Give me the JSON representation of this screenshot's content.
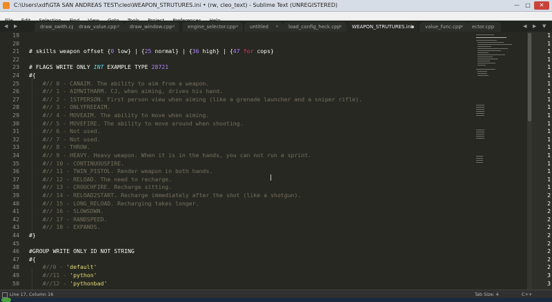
{
  "window": {
    "title": "C:\\Users\\xdf\\GTA SAN ANDREAS TEST\\cleo\\WEAPON_STRUTURES.ini • (rw, cleo_text) - Sublime Text (UNREGISTERED)",
    "minimize_glyph": "—",
    "maximize_glyph": "□",
    "close_glyph": "✕"
  },
  "menu": [
    "File",
    "Edit",
    "Selection",
    "Find",
    "View",
    "Goto",
    "Tools",
    "Project",
    "Preferences",
    "Help"
  ],
  "tab_arrows": {
    "left": "◀",
    "right": "▶",
    "overflow": "▼"
  },
  "tabs": [
    {
      "label": "draw_swith.cpp",
      "close": "×",
      "active": false
    },
    {
      "label": "draw_value.cpp",
      "close": "×",
      "active": false
    },
    {
      "label": "draw_window.cpp",
      "close": "×",
      "active": false
    },
    {
      "label": "engine_selector.cpp",
      "close": "×",
      "active": false
    },
    {
      "label": "untitled",
      "close": "×",
      "active": false
    },
    {
      "label": "load_config_heck.cpp",
      "close": "×",
      "active": false
    },
    {
      "label": "WEAPON_STRUTURES.ini",
      "close": "",
      "active": true
    },
    {
      "label": "value_func.cpp",
      "close": "×",
      "active": false
    },
    {
      "label": "ector.cpp",
      "close": "",
      "active": false
    }
  ],
  "editor": {
    "lines": [
      {
        "num": "19",
        "text": ""
      },
      {
        "num": "20",
        "text": ""
      },
      {
        "num": "21",
        "text": "# skills weapon offset {0 low} | {25 normal} | {36 high} | {47 for cops}"
      },
      {
        "num": "22",
        "text": ""
      },
      {
        "num": "23",
        "text": "# FLAGS WRITE ONLY INT EXAMPLE TYPE 28721"
      },
      {
        "num": "24",
        "text": "#{"
      },
      {
        "num": "25",
        "text": "    #// 0 - CANAIM. The ability to aim from a weapon."
      },
      {
        "num": "26",
        "text": "    #// 1 - AIMWITHARM. CJ, when aiming, drives his hand."
      },
      {
        "num": "27",
        "text": "    #// 2 - 1STPERSON. First person view when aiming (like a grenade launcher and a sniper rifle)."
      },
      {
        "num": "28",
        "text": "    #// 3 - ONLYFREEAIM."
      },
      {
        "num": "29",
        "text": "    #// 4 - MOVEAIM. The ability to move when aiming."
      },
      {
        "num": "30",
        "text": "    #// 5 - MOVEFIRE. The ability to move around when shooting."
      },
      {
        "num": "31",
        "text": "    #// 6 - Not used."
      },
      {
        "num": "32",
        "text": "    #// 7 - Not used."
      },
      {
        "num": "33",
        "text": "    #// 8 - THROW."
      },
      {
        "num": "34",
        "text": "    #// 9 - HEAVY. Heavy weapon. When it is in the hands, you can not run a sprint."
      },
      {
        "num": "35",
        "text": "    #// 10 - CONTINUOUSFIRE."
      },
      {
        "num": "36",
        "text": "    #// 11 - TWIN_PISTOL. Render weapon in both hands."
      },
      {
        "num": "37",
        "text": "    #// 12 - RELOAD. The need to recharge."
      },
      {
        "num": "38",
        "text": "    #// 13 - CROUCHFIRE. Recharge sitting."
      },
      {
        "num": "39",
        "text": "    #// 14 - RELOAD2START. Recharge immediately after the shot (like a shotgun)."
      },
      {
        "num": "40",
        "text": "    #// 15 - LONG_RELOAD. Recharging takes longer."
      },
      {
        "num": "41",
        "text": "    #// 16 - SLOWSDWN."
      },
      {
        "num": "42",
        "text": "    #// 17 - RANDSPEED."
      },
      {
        "num": "43",
        "text": "    #// 18 - EXPANDS."
      },
      {
        "num": "44",
        "text": "#}"
      },
      {
        "num": "45",
        "text": ""
      },
      {
        "num": "46",
        "text": "#GROUP WRITE ONLY ID NOT STRING"
      },
      {
        "num": "47",
        "text": "#{"
      },
      {
        "num": "48",
        "text": "    #//0 - 'default'"
      },
      {
        "num": "49",
        "text": "    #//11 - 'python'"
      },
      {
        "num": "50",
        "text": "    #//12 - 'pythonbad'"
      }
    ]
  },
  "side_numbers": [
    "1",
    "1",
    "1",
    "1",
    "1",
    "1",
    "1",
    "1",
    "1",
    "1",
    "1",
    "1",
    "1",
    "1",
    "1",
    "1",
    "1",
    "1",
    "1",
    "1",
    "2",
    "2",
    "2",
    "2",
    "2",
    "2",
    "2",
    "2",
    "2",
    "2",
    "3",
    "3",
    "3"
  ],
  "status": {
    "position": "Line 17, Column 16",
    "tab_size": "Tab Size: 4",
    "syntax": "C++"
  },
  "colors": {
    "background": "#272822",
    "comment": "#75715e",
    "number": "#ae81ff",
    "keyword": "#f92672",
    "type": "#66d9ef",
    "string": "#e6db74",
    "text": "#f8f8f2"
  }
}
